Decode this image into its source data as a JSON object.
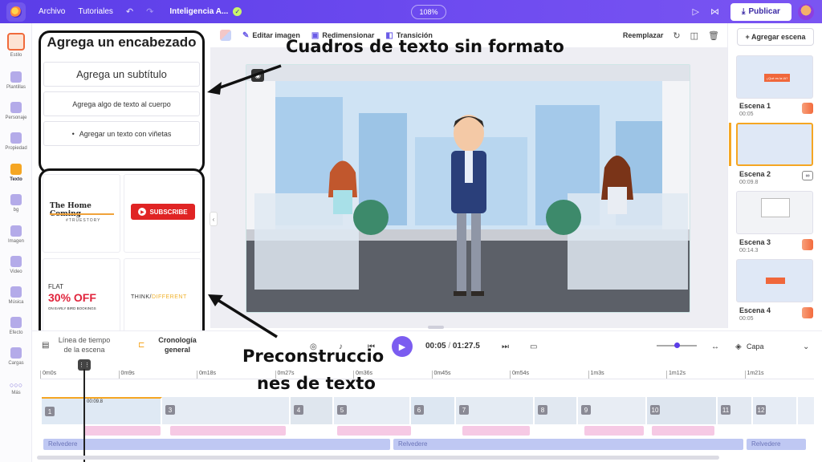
{
  "topbar": {
    "archivo": "Archivo",
    "tutoriales": "Tutoriales",
    "undo_icon": "undo-icon",
    "redo_icon": "redo-icon",
    "project_title": "Inteligencia A...",
    "zoom": "108%",
    "publish": "Publicar"
  },
  "rail": {
    "items": [
      "Estilo",
      "Plantillas",
      "Personaje",
      "Propiedad",
      "Texto",
      "bg",
      "Imagen",
      "Video",
      "Música",
      "Efecto",
      "Cargas",
      "Más"
    ]
  },
  "text_panel": {
    "heading": "Agrega un encabezado",
    "subtitle": "Agrega un subtítulo",
    "body": "Agrega algo de texto al cuerpo",
    "bullet": "Agregar un texto con viñetas"
  },
  "presets": {
    "home_coming": "The Home Coming",
    "truestory": "#TRUESTORY",
    "subscribe": "SUBSCRIBE",
    "flat": "FLAT",
    "off": "30% OFF",
    "early_bird": "ON EARLY BIRD BOOKINGS",
    "think": "THINK/",
    "different": "DIFFERENT"
  },
  "toolbar": {
    "edit_image": "Editar imagen",
    "resize": "Redimensionar",
    "transition": "Transición",
    "replace": "Reemplazar"
  },
  "annotations": {
    "raw_text_boxes": "Cuadros de texto sin formato",
    "prebuilt_line1": "Preconstruccio",
    "prebuilt_line2": "nes de texto"
  },
  "scenes": {
    "add": "+ Agregar escena",
    "list": [
      {
        "name": "Escena 1",
        "duration": "00:05",
        "thumb_label": "¿Qué es la IA?"
      },
      {
        "name": "Escena 2",
        "duration": "00:09.8"
      },
      {
        "name": "Escena 3",
        "duration": "00:14.3"
      },
      {
        "name": "Escena 4",
        "duration": "00:05"
      }
    ]
  },
  "timeline": {
    "tab_scene_line1": "Línea de tiempo",
    "tab_scene_line2": "de la escena",
    "tab_general_line1": "Cronología",
    "tab_general_line2": "general",
    "current_time": "00:05",
    "separator": "/",
    "total_time": "01:27.5",
    "layer": "Capa",
    "playhead_label": "00:09.8",
    "ruler": [
      "0m0s",
      "0m9s",
      "0m18s",
      "0m27s",
      "0m36s",
      "0m45s",
      "0m54s",
      "1m3s",
      "1m12s",
      "1m21s"
    ],
    "segments": [
      "1",
      "3",
      "4",
      "5",
      "6",
      "7",
      "8",
      "9",
      "10",
      "11",
      "12"
    ],
    "audio_label": "Relvedere"
  },
  "colors": {
    "brand_purple": "#6a47ee",
    "accent_orange": "#f5a623",
    "annotation_black": "#111111"
  }
}
